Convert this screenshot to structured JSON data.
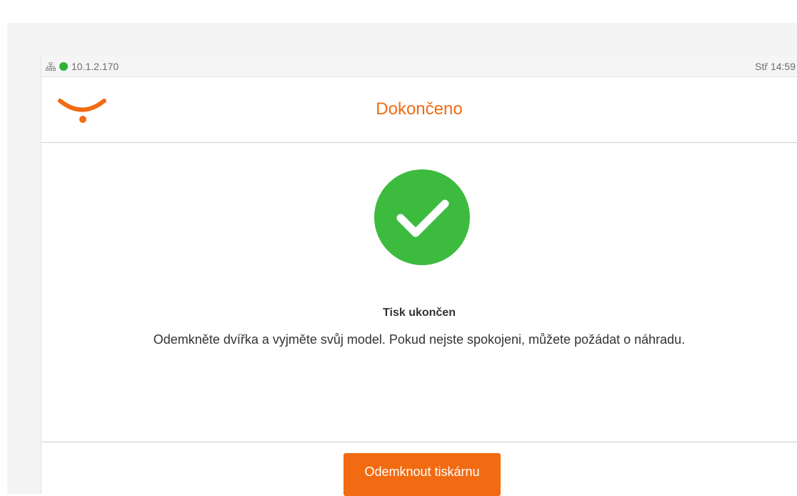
{
  "status_bar": {
    "network_icon": "network-icon",
    "connection_color": "#2db33a",
    "ip_address": "10.1.2.170",
    "clock": "Stř 14:59"
  },
  "header": {
    "logo": "smile-logo",
    "title": "Dokončeno"
  },
  "content": {
    "icon": "checkmark-circle-icon",
    "icon_color": "#3dbb3f",
    "title": "Tisk ukončen",
    "message": "Odemkněte dvířka a vyjměte svůj model. Pokud nejste spokojeni, můžete požádat o náhradu."
  },
  "footer": {
    "unlock_button_label": "Odemknout tiskárnu"
  },
  "colors": {
    "accent": "#f26b12"
  }
}
